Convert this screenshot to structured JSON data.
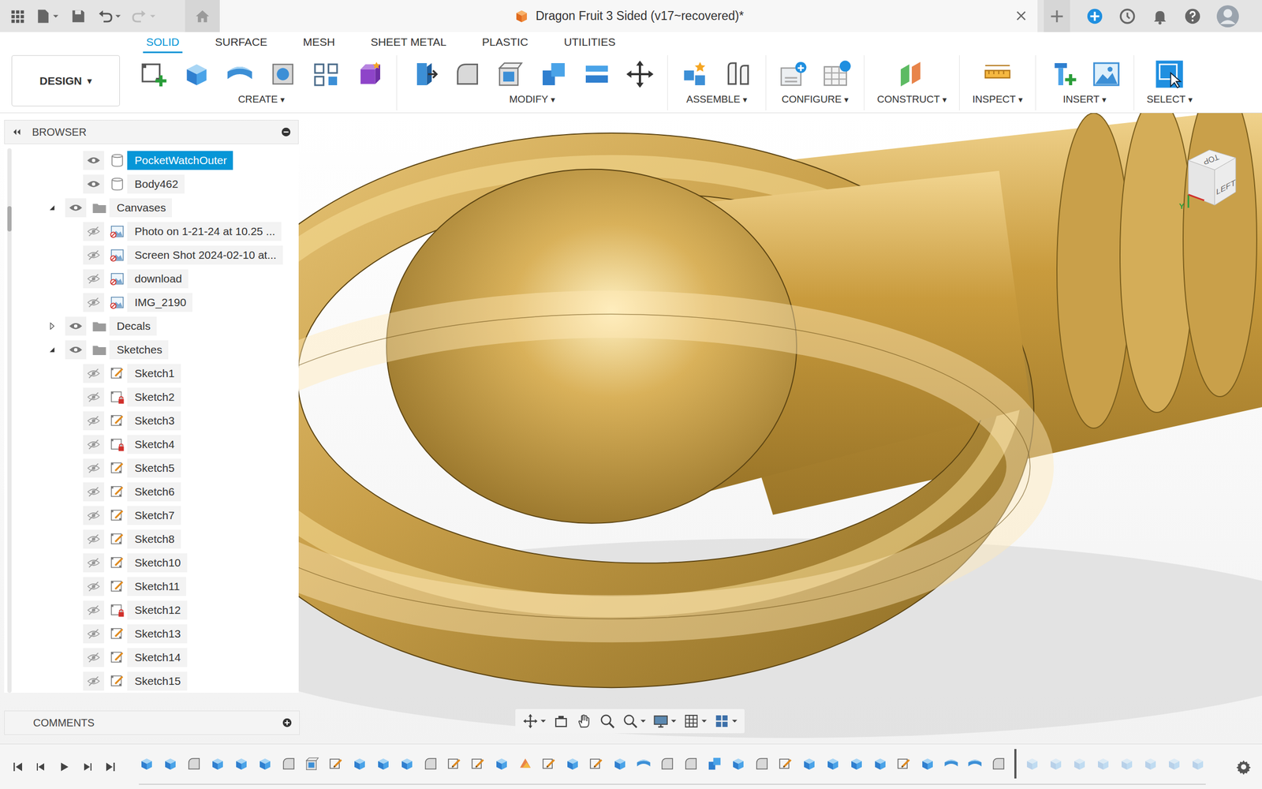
{
  "window": {
    "title": "Dragon Fruit 3 Sided (v17~recovered)*"
  },
  "workspace": {
    "label": "DESIGN",
    "caret": "▾"
  },
  "tabs": [
    {
      "label": "SOLID",
      "selected": true
    },
    {
      "label": "SURFACE",
      "selected": false
    },
    {
      "label": "MESH",
      "selected": false
    },
    {
      "label": "SHEET METAL",
      "selected": false
    },
    {
      "label": "PLASTIC",
      "selected": false
    },
    {
      "label": "UTILITIES",
      "selected": false
    }
  ],
  "toolbar": {
    "caret": "▾",
    "groups": [
      {
        "label": "CREATE"
      },
      {
        "label": "MODIFY"
      },
      {
        "label": "ASSEMBLE"
      },
      {
        "label": "CONFIGURE"
      },
      {
        "label": "CONSTRUCT"
      },
      {
        "label": "INSPECT"
      },
      {
        "label": "INSERT"
      },
      {
        "label": "SELECT"
      }
    ]
  },
  "browser": {
    "title": "BROWSER",
    "items": [
      {
        "label": "PocketWatchOuter",
        "kind": "body",
        "depth": 1,
        "visible": true,
        "selected": true
      },
      {
        "label": "Body462",
        "kind": "body",
        "depth": 1,
        "visible": true,
        "selected": false
      },
      {
        "label": "Canvases",
        "kind": "folder",
        "depth": 0,
        "visible": true,
        "expanded": true,
        "selected": false
      },
      {
        "label": "Photo on 1-21-24 at 10.25 ...",
        "kind": "canvas",
        "depth": 1,
        "visible": false,
        "selected": false
      },
      {
        "label": "Screen Shot 2024-02-10 at...",
        "kind": "canvas",
        "depth": 1,
        "visible": false,
        "selected": false
      },
      {
        "label": "download",
        "kind": "canvas",
        "depth": 1,
        "visible": false,
        "selected": false
      },
      {
        "label": "IMG_2190",
        "kind": "canvas",
        "depth": 1,
        "visible": false,
        "selected": false
      },
      {
        "label": "Decals",
        "kind": "folder",
        "depth": 0,
        "visible": true,
        "expanded": false,
        "selected": false
      },
      {
        "label": "Sketches",
        "kind": "folder",
        "depth": 0,
        "visible": true,
        "expanded": true,
        "selected": false
      },
      {
        "label": "Sketch1",
        "kind": "sketch",
        "depth": 1,
        "visible": false,
        "locked": false,
        "selected": false
      },
      {
        "label": "Sketch2",
        "kind": "sketch",
        "depth": 1,
        "visible": false,
        "locked": true,
        "selected": false
      },
      {
        "label": "Sketch3",
        "kind": "sketch",
        "depth": 1,
        "visible": false,
        "locked": false,
        "selected": false
      },
      {
        "label": "Sketch4",
        "kind": "sketch",
        "depth": 1,
        "visible": false,
        "locked": true,
        "selected": false
      },
      {
        "label": "Sketch5",
        "kind": "sketch",
        "depth": 1,
        "visible": false,
        "locked": false,
        "selected": false
      },
      {
        "label": "Sketch6",
        "kind": "sketch",
        "depth": 1,
        "visible": false,
        "locked": false,
        "selected": false
      },
      {
        "label": "Sketch7",
        "kind": "sketch",
        "depth": 1,
        "visible": false,
        "locked": false,
        "selected": false
      },
      {
        "label": "Sketch8",
        "kind": "sketch",
        "depth": 1,
        "visible": false,
        "locked": false,
        "selected": false
      },
      {
        "label": "Sketch10",
        "kind": "sketch",
        "depth": 1,
        "visible": false,
        "locked": false,
        "selected": false
      },
      {
        "label": "Sketch11",
        "kind": "sketch",
        "depth": 1,
        "visible": false,
        "locked": false,
        "selected": false
      },
      {
        "label": "Sketch12",
        "kind": "sketch",
        "depth": 1,
        "visible": false,
        "locked": true,
        "selected": false
      },
      {
        "label": "Sketch13",
        "kind": "sketch",
        "depth": 1,
        "visible": false,
        "locked": false,
        "selected": false
      },
      {
        "label": "Sketch14",
        "kind": "sketch",
        "depth": 1,
        "visible": false,
        "locked": false,
        "selected": false
      },
      {
        "label": "Sketch15",
        "kind": "sketch",
        "depth": 1,
        "visible": false,
        "locked": false,
        "selected": false
      }
    ]
  },
  "comments": {
    "title": "COMMENTS"
  },
  "viewcube": {
    "front": "LEFT",
    "top": "TOP",
    "axis": "Y"
  },
  "timeline": {
    "features": [
      {
        "kind": "box",
        "rolled_back": false
      },
      {
        "kind": "box",
        "rolled_back": false
      },
      {
        "kind": "fillet",
        "rolled_back": false
      },
      {
        "kind": "box",
        "rolled_back": false
      },
      {
        "kind": "box",
        "rolled_back": false
      },
      {
        "kind": "box",
        "rolled_back": false
      },
      {
        "kind": "fillet",
        "rolled_back": false
      },
      {
        "kind": "shell",
        "rolled_back": false
      },
      {
        "kind": "tsketch",
        "rolled_back": false
      },
      {
        "kind": "box",
        "rolled_back": false
      },
      {
        "kind": "box",
        "rolled_back": false
      },
      {
        "kind": "box",
        "rolled_back": false
      },
      {
        "kind": "fillet",
        "rolled_back": false
      },
      {
        "kind": "tsketch",
        "rolled_back": false
      },
      {
        "kind": "tsketch",
        "rolled_back": false
      },
      {
        "kind": "box",
        "rolled_back": false
      },
      {
        "kind": "appearance",
        "rolled_back": false
      },
      {
        "kind": "tsketch",
        "rolled_back": false
      },
      {
        "kind": "box",
        "rolled_back": false
      },
      {
        "kind": "tsketch",
        "rolled_back": false
      },
      {
        "kind": "box",
        "rolled_back": false
      },
      {
        "kind": "revolve",
        "rolled_back": false
      },
      {
        "kind": "fillet",
        "rolled_back": false
      },
      {
        "kind": "fillet",
        "rolled_back": false
      },
      {
        "kind": "combine",
        "rolled_back": false
      },
      {
        "kind": "box",
        "rolled_back": false
      },
      {
        "kind": "fillet",
        "rolled_back": false
      },
      {
        "kind": "tsketch",
        "rolled_back": false
      },
      {
        "kind": "box",
        "rolled_back": false
      },
      {
        "kind": "box",
        "rolled_back": false
      },
      {
        "kind": "box",
        "rolled_back": false
      },
      {
        "kind": "box",
        "rolled_back": false
      },
      {
        "kind": "tsketch",
        "rolled_back": false
      },
      {
        "kind": "box",
        "rolled_back": false
      },
      {
        "kind": "revolve",
        "rolled_back": false
      },
      {
        "kind": "revolve",
        "rolled_back": false
      },
      {
        "kind": "fillet",
        "rolled_back": false
      },
      {
        "kind": "box",
        "rolled_back": true
      },
      {
        "kind": "box",
        "rolled_back": true
      },
      {
        "kind": "box",
        "rolled_back": true
      },
      {
        "kind": "box",
        "rolled_back": true
      },
      {
        "kind": "box",
        "rolled_back": true
      },
      {
        "kind": "box",
        "rolled_back": true
      },
      {
        "kind": "box",
        "rolled_back": true
      },
      {
        "kind": "box",
        "rolled_back": true
      }
    ]
  }
}
